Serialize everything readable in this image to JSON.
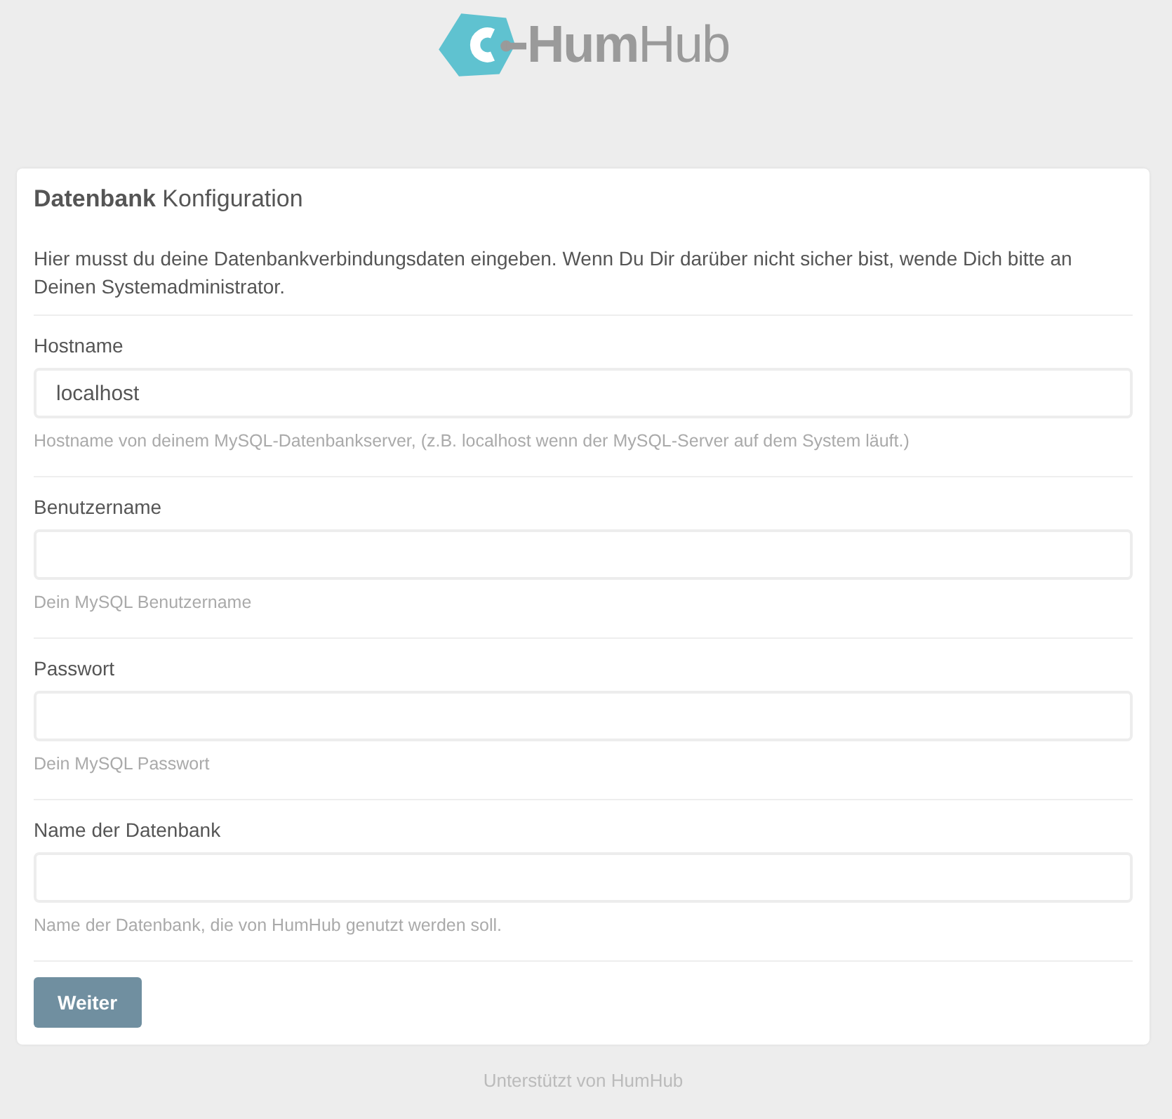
{
  "logo": {
    "bold": "Hum",
    "light": "Hub"
  },
  "panel": {
    "title_bold": "Datenbank",
    "title_light": "Konfiguration",
    "intro": "Hier musst du deine Datenbankverbindungsdaten eingeben. Wenn Du Dir darüber nicht sicher bist, wende Dich bitte an Deinen Systemadministrator."
  },
  "fields": [
    {
      "label": "Hostname",
      "value": "localhost",
      "hint": "Hostname von deinem MySQL-Datenbankserver, (z.B. localhost wenn der MySQL-Server auf dem System läuft.)"
    },
    {
      "label": "Benutzername",
      "hint": "Dein MySQL Benutzername"
    },
    {
      "label": "Passwort",
      "hint": "Dein MySQL Passwort"
    },
    {
      "label": "Name der Datenbank",
      "hint": "Name der Datenbank, die von HumHub genutzt werden soll."
    }
  ],
  "submit": "Weiter",
  "footer": "Unterstützt von HumHub"
}
